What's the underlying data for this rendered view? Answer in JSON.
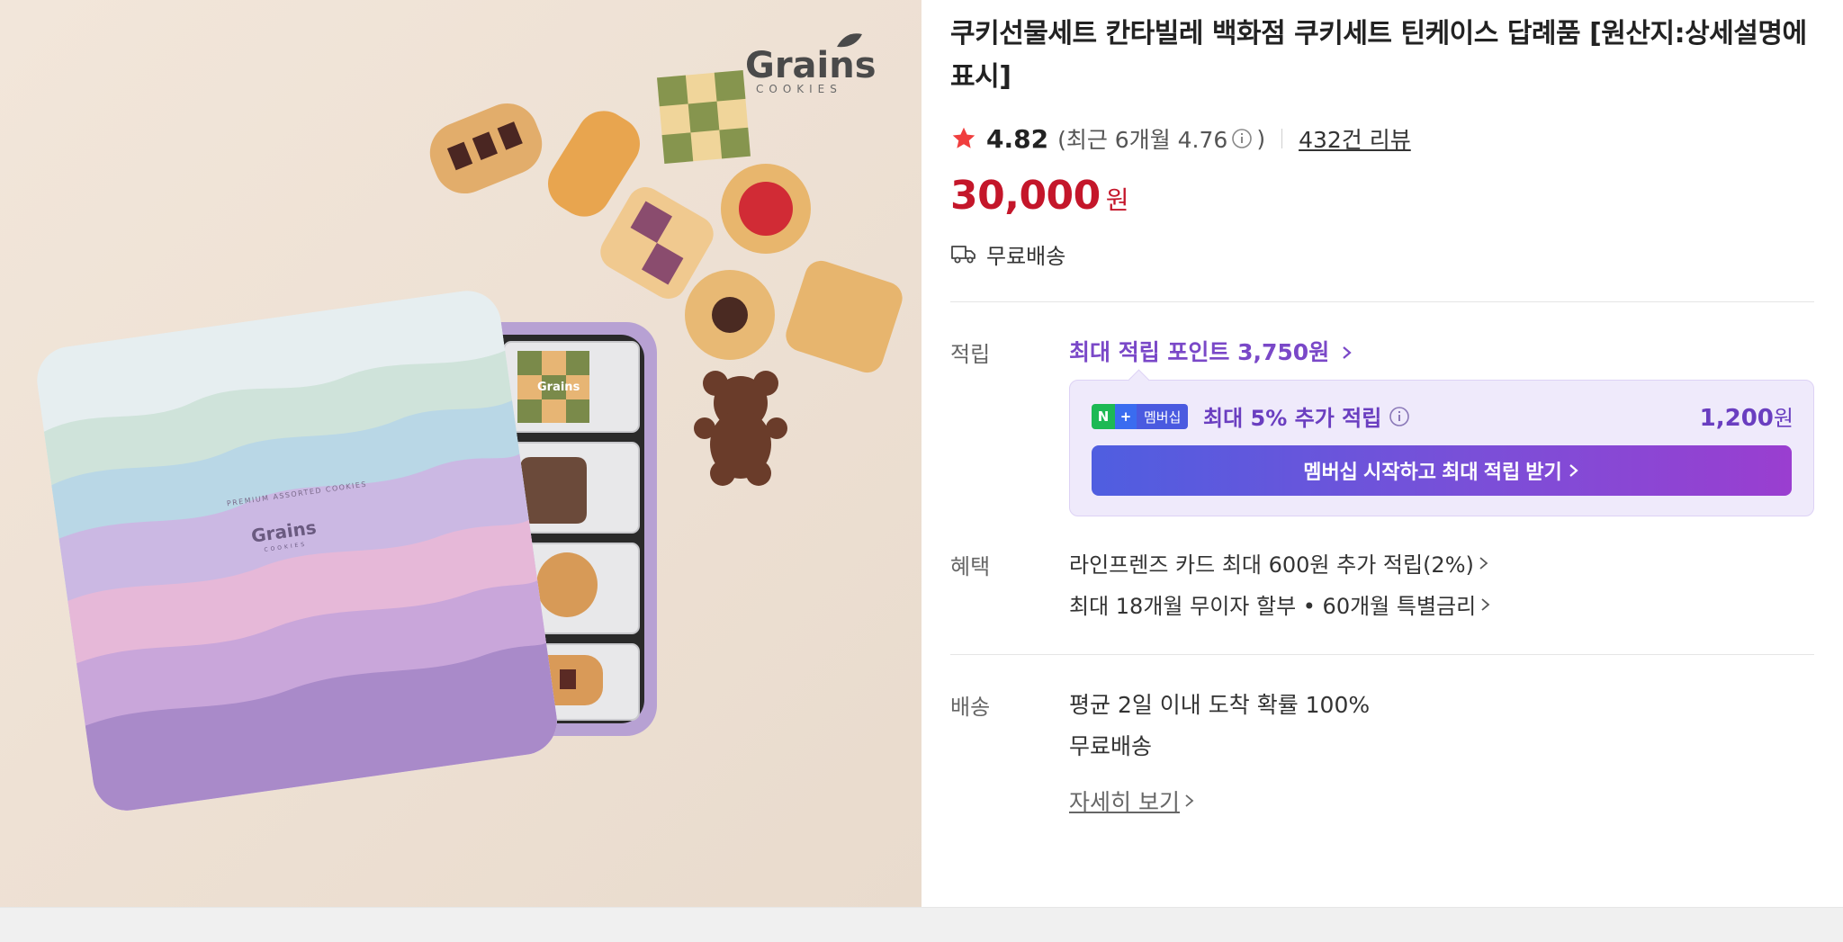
{
  "product": {
    "brand_logo": "Grains",
    "brand_logo_sub": "COOKIES",
    "tin_label_top": "PREMIUM ASSORTED COOKIES",
    "tin_label_brand": "Grains",
    "tin_label_sub": "COOKIES",
    "cookie_wrapper_label": "Grains",
    "title": "쿠키선물세트 칸타빌레 백화점 쿠키세트 틴케이스 답례품 [원산지:상세설명에 표시]"
  },
  "rating": {
    "score": "4.82",
    "recent_prefix": "(최근 6개월 4.76",
    "recent_suffix": ")",
    "reviews": "432건 리뷰",
    "star_color": "#f03e3e"
  },
  "price": {
    "amount": "30,000",
    "unit": "원",
    "color": "#c4162a"
  },
  "shipping_summary": {
    "label": "무료배송"
  },
  "points": {
    "label": "적립",
    "max_points": "최대 적립 포인트 3,750원",
    "membership": {
      "badge_n": "N",
      "badge_plus": "+",
      "badge_text": "멤버십",
      "extra": "최대 5% 추가 적립",
      "amount": "1,200",
      "amount_unit": "원",
      "cta": "멤버십 시작하고 최대 적립 받기"
    }
  },
  "benefits": {
    "label": "혜택",
    "items": [
      "라인프렌즈 카드 최대 600원 추가 적립(2%)",
      "최대 18개월 무이자 할부 • 60개월 특별금리"
    ]
  },
  "delivery": {
    "label": "배송",
    "lines": [
      "평균 2일 이내 도착 확률 100%",
      "무료배송"
    ],
    "more": "자세히 보기"
  },
  "colors": {
    "accent_purple": "#7a48c8",
    "price_red": "#c4162a",
    "photo_bg": "#ede0d3"
  },
  "icons": [
    "star-icon",
    "info-icon",
    "truck-icon",
    "chevron-right-icon"
  ]
}
